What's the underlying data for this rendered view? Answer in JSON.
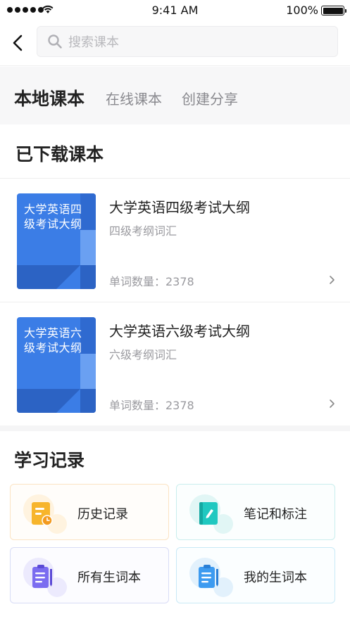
{
  "status_bar": {
    "time": "9:41 AM",
    "battery": "100%"
  },
  "search": {
    "placeholder": "搜索课本"
  },
  "tabs": [
    {
      "label": "本地课本",
      "active": true
    },
    {
      "label": "在线课本",
      "active": false
    },
    {
      "label": "创建分享",
      "active": false
    }
  ],
  "downloaded": {
    "title": "已下载课本",
    "books": [
      {
        "cover_text": "大学英语四级考试大纲",
        "title": "大学英语四级考试大纲",
        "subtitle": "四级考纲词汇",
        "word_count": "单词数量：2378"
      },
      {
        "cover_text": "大学英语六级考试大纲",
        "title": "大学英语六级考试大纲",
        "subtitle": "六级考纲词汇",
        "word_count": "单词数量：2378"
      }
    ]
  },
  "study_records": {
    "title": "学习记录",
    "cards": [
      {
        "label": "历史记录",
        "icon": "history-icon",
        "color": "#f5a623"
      },
      {
        "label": "笔记和标注",
        "icon": "notes-icon",
        "color": "#1fc8c0"
      },
      {
        "label": "所有生词本",
        "icon": "all-vocab-icon",
        "color": "#7b6cf0"
      },
      {
        "label": "我的生词本",
        "icon": "my-vocab-icon",
        "color": "#3d9bf0"
      }
    ]
  },
  "colors": {
    "accent": "#5fd3f3",
    "book_cover": "#3b7de6"
  }
}
